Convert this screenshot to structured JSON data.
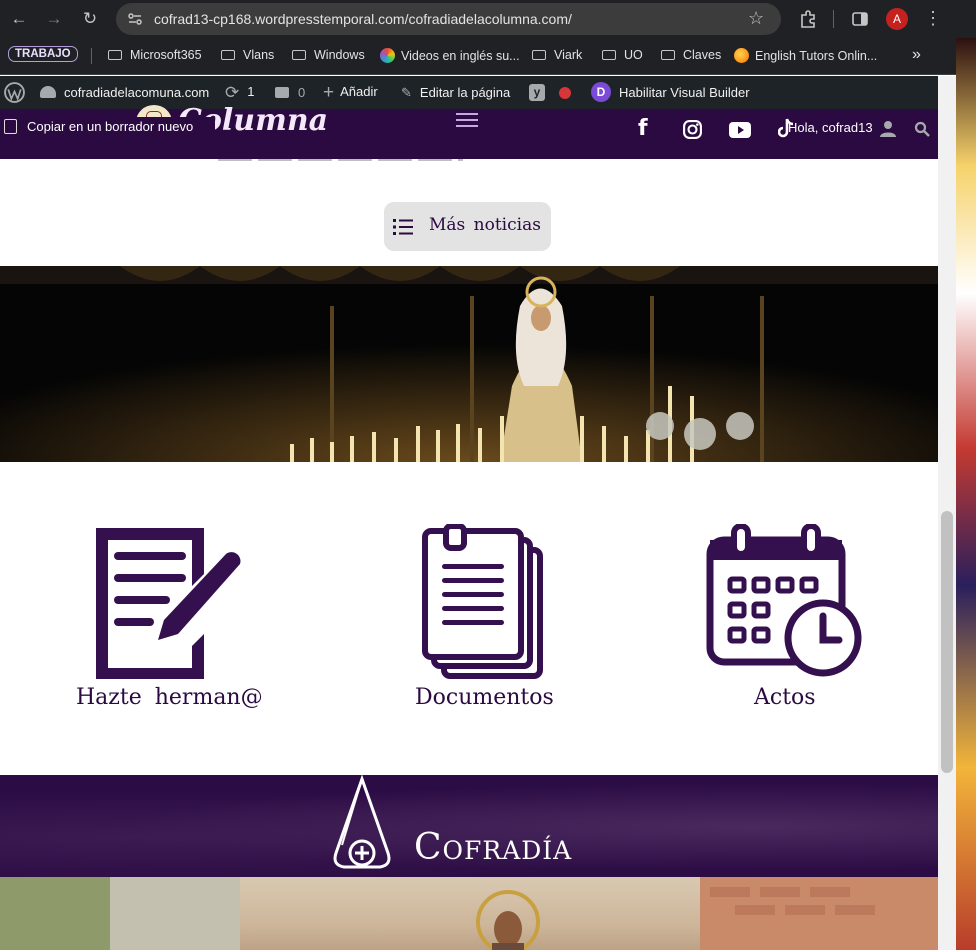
{
  "browser": {
    "url": "cofrad13-cp168.wordpresstemporal.com/cofradiadelacolumna.com/",
    "profile_initial": "A"
  },
  "bookmarks": {
    "group_label": "TRABAJO",
    "items": [
      "Microsoft365",
      "Vlans",
      "Windows",
      "Videos en inglés su...",
      "Viark",
      "UO",
      "Claves",
      "English Tutors Onlin..."
    ],
    "overflow": "»"
  },
  "wp_admin": {
    "site": "cofradiadelacomuna.com",
    "updates": "1",
    "comments": "0",
    "add": "Añadir",
    "edit": "Editar la página",
    "visual_builder": "Habilitar Visual Builder",
    "copy_draft": "Copiar en un borrador nuevo",
    "greeting": "Hola, cofrad13"
  },
  "site": {
    "logo_text": "Columna",
    "more_news": "Más noticias",
    "tiles": [
      {
        "label": "Hazte herman@"
      },
      {
        "label": "Documentos"
      },
      {
        "label": "Actos"
      }
    ],
    "section_title": "Cofradía"
  },
  "colors": {
    "brand_purple": "#2a0a40",
    "header_bg": "#2a0a40",
    "button_bg": "#e3e3e3",
    "admin_bar": "#1d2327"
  }
}
